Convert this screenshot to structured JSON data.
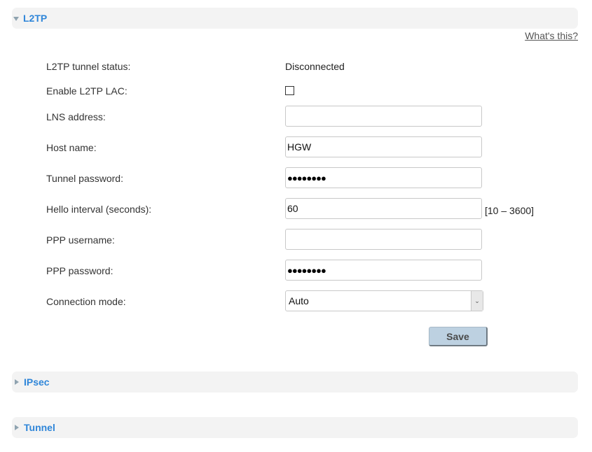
{
  "sections": [
    {
      "title": "L2TP",
      "expanded": true,
      "icon": "triangle-down-icon"
    },
    {
      "title": "IPsec",
      "expanded": false,
      "icon": "triangle-right-icon"
    },
    {
      "title": "Tunnel",
      "expanded": false,
      "icon": "triangle-right-icon"
    }
  ],
  "help_link": "What's this?",
  "form": {
    "tunnel_status": {
      "label": "L2TP tunnel status:",
      "value": "Disconnected"
    },
    "enable_lac": {
      "label": "Enable L2TP LAC:",
      "checked": false
    },
    "lns_address": {
      "label": "LNS address:",
      "value": ""
    },
    "host_name": {
      "label": "Host name:",
      "value": "HGW"
    },
    "tunnel_password": {
      "label": "Tunnel password:",
      "value": "●●●●●●●●"
    },
    "hello_interval": {
      "label": "Hello interval (seconds):",
      "value": "60",
      "range": "[10 – 3600]"
    },
    "ppp_username": {
      "label": "PPP username:",
      "value": ""
    },
    "ppp_password": {
      "label": "PPP password:",
      "value": "●●●●●●●●"
    },
    "connection_mode": {
      "label": "Connection mode:",
      "value": "Auto"
    }
  },
  "save_label": "Save",
  "colors": {
    "accent": "#2f86d9",
    "header_bg": "#f3f3f3",
    "button_bg": "#bdd1e1"
  }
}
